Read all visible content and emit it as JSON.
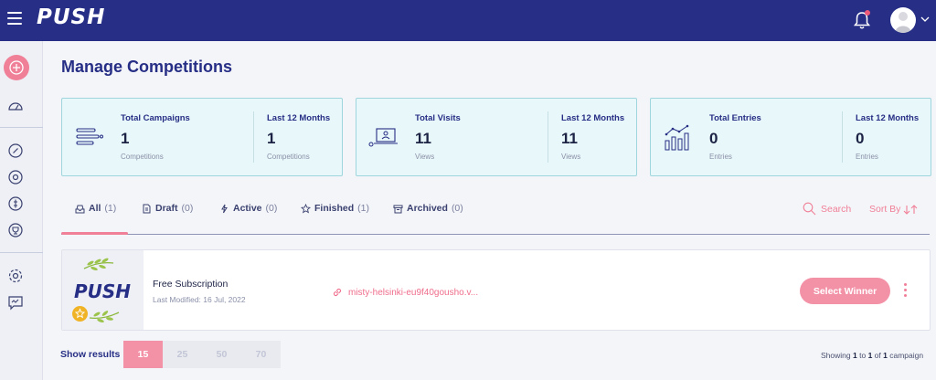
{
  "app": {
    "logo": "PUSH"
  },
  "page": {
    "title": "Manage Competitions"
  },
  "stats": [
    {
      "icon": "list-icon",
      "label_a": "Total Campaigns",
      "value_a": "1",
      "sub_a": "Competitions",
      "label_b": "Last 12 Months",
      "value_b": "1",
      "sub_b": "Competitions"
    },
    {
      "icon": "laptop-user-icon",
      "label_a": "Total Visits",
      "value_a": "11",
      "sub_a": "Views",
      "label_b": "Last 12 Months",
      "value_b": "11",
      "sub_b": "Views"
    },
    {
      "icon": "bar-trend-icon",
      "label_a": "Total Entries",
      "value_a": "0",
      "sub_a": "Entries",
      "label_b": "Last 12 Months",
      "value_b": "0",
      "sub_b": "Entries"
    }
  ],
  "tabs": [
    {
      "label": "All",
      "count": "(1)"
    },
    {
      "label": "Draft",
      "count": "(0)"
    },
    {
      "label": "Active",
      "count": "(0)"
    },
    {
      "label": "Finished",
      "count": "(1)"
    },
    {
      "label": "Archived",
      "count": "(0)"
    }
  ],
  "toolbar": {
    "search": "Search",
    "sort": "Sort By"
  },
  "campaign": {
    "thumb_logo": "PUSH",
    "title": "Free Subscription",
    "modified": "Last Modified: 16 Jul, 2022",
    "link": "misty-helsinki-eu9f40gousho.v...",
    "action": "Select Winner"
  },
  "pagination": {
    "label": "Show results",
    "options": [
      "15",
      "25",
      "50",
      "70"
    ],
    "selected": "15",
    "summary_prefix": "Showing",
    "from": "1",
    "to_word": "to",
    "to": "1",
    "of_word": "of",
    "total": "1",
    "summary_suffix": "campaign"
  },
  "colors": {
    "header": "#262e85",
    "accent": "#f07f98",
    "card_bg": "#e8f7f9",
    "card_border": "#9fd5dc"
  }
}
